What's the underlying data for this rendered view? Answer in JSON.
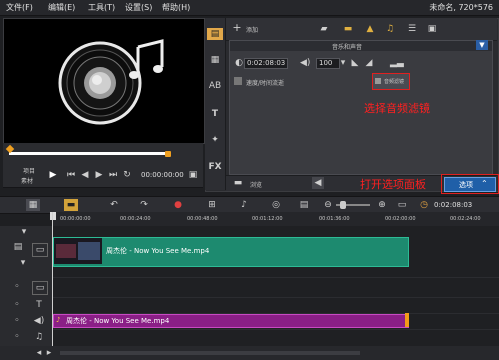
{
  "menu": {
    "items": [
      "文件(F)",
      "编辑(E)",
      "工具(T)",
      "设置(S)",
      "帮助(H)"
    ],
    "title_info": "未命名, 720*576"
  },
  "preview": {
    "mode_top": "项目",
    "mode_bottom": "素材",
    "timecode": "00:00:00:00"
  },
  "options": {
    "add_label": "添加",
    "tab_label": "音乐和声音",
    "duration": "0:02:08:03",
    "volume": "100",
    "extract_label": "速度/时间流逝",
    "audio_filter_label": "音频滤镜",
    "footer_label": "浏览"
  },
  "annotations": {
    "select_filter": "选择音频滤镜",
    "open_panel": "打开选项面板"
  },
  "options_button": {
    "label": "选项"
  },
  "timeline": {
    "timecode": "0:02:08:03",
    "ruler_ticks": [
      "00:00:00:00",
      "00:00:24:00",
      "00:00:48:00",
      "00:01:12:00",
      "00:01:36:00",
      "00:02:00:00",
      "00:02:24:00"
    ],
    "video_clip": "周杰伦 - Now You See Me.mp4",
    "audio_clip": "周杰伦 - Now You See Me.mp4"
  },
  "icons": [
    "music-note-icon",
    "speaker-icon",
    "play-icon",
    "fx-icon",
    "text-icon",
    "film-icon",
    "undo-icon",
    "redo-icon",
    "zoom-in-icon",
    "zoom-out-icon"
  ],
  "colors": {
    "video_clip": "#1d8a6f",
    "audio_clip": "#8a1f86",
    "annotation": "#ff2020",
    "options_button": "#1f5fa8"
  }
}
